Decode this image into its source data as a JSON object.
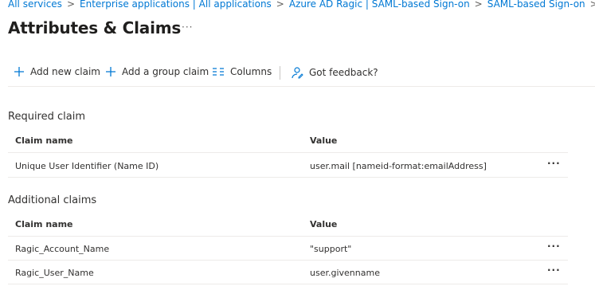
{
  "breadcrumb": {
    "items": [
      "All services",
      "Enterprise applications | All applications",
      "Azure AD Ragic | SAML-based Sign-on",
      "SAML-based Sign-on"
    ],
    "separator": ">"
  },
  "page": {
    "title": "Attributes & Claims",
    "more": "···"
  },
  "toolbar": {
    "add_new_claim": "Add new claim",
    "add_group_claim": "Add a group claim",
    "columns": "Columns",
    "feedback": "Got feedback?",
    "icons": [
      "plus-icon",
      "plus-icon",
      "columns-icon",
      "feedback-icon"
    ],
    "accent_color": "#0078d4"
  },
  "required_claim": {
    "title": "Required claim",
    "columns": [
      "Claim name",
      "Value"
    ],
    "rows": [
      {
        "name": "Unique User Identifier (Name ID)",
        "value": "user.mail [nameid-format:emailAddress]",
        "more": "···"
      }
    ]
  },
  "additional_claims": {
    "title": "Additional claims",
    "columns": [
      "Claim name",
      "Value"
    ],
    "rows": [
      {
        "name": "Ragic_Account_Name",
        "value": "\"support\"",
        "more": "···"
      },
      {
        "name": "Ragic_User_Name",
        "value": "user.givenname",
        "more": "···"
      }
    ]
  }
}
